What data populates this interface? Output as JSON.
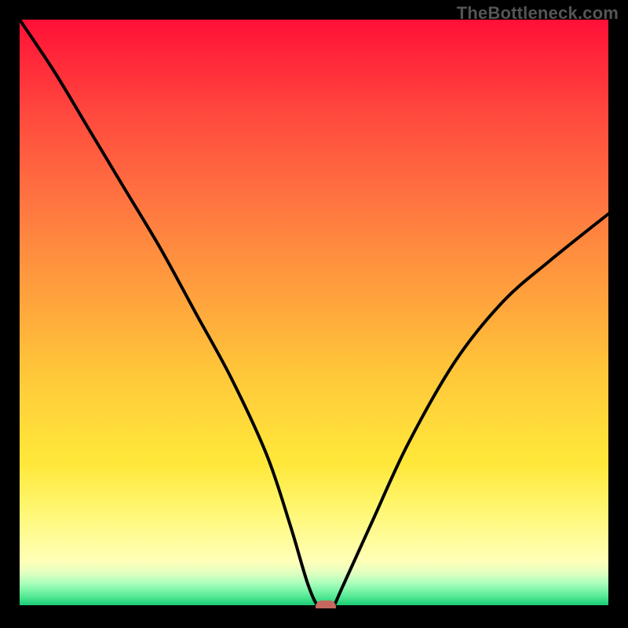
{
  "watermark": "TheBottleneck.com",
  "chart_data": {
    "type": "line",
    "title": "",
    "xlabel": "",
    "ylabel": "",
    "xlim": [
      0,
      100
    ],
    "ylim": [
      0,
      100
    ],
    "x": [
      0,
      6,
      12,
      18,
      24,
      30,
      36,
      42,
      46,
      49,
      51,
      53,
      55,
      60,
      66,
      74,
      82,
      90,
      100
    ],
    "values": [
      100,
      91,
      81,
      71,
      61,
      50,
      39,
      26,
      14,
      4,
      0,
      0,
      4,
      15,
      28,
      42,
      52,
      59,
      67
    ],
    "marker": {
      "x": 52,
      "y": 0
    },
    "background_gradient": {
      "top": "#ff1037",
      "mid": "#ffd93a",
      "bottom": "#10c06b"
    }
  }
}
